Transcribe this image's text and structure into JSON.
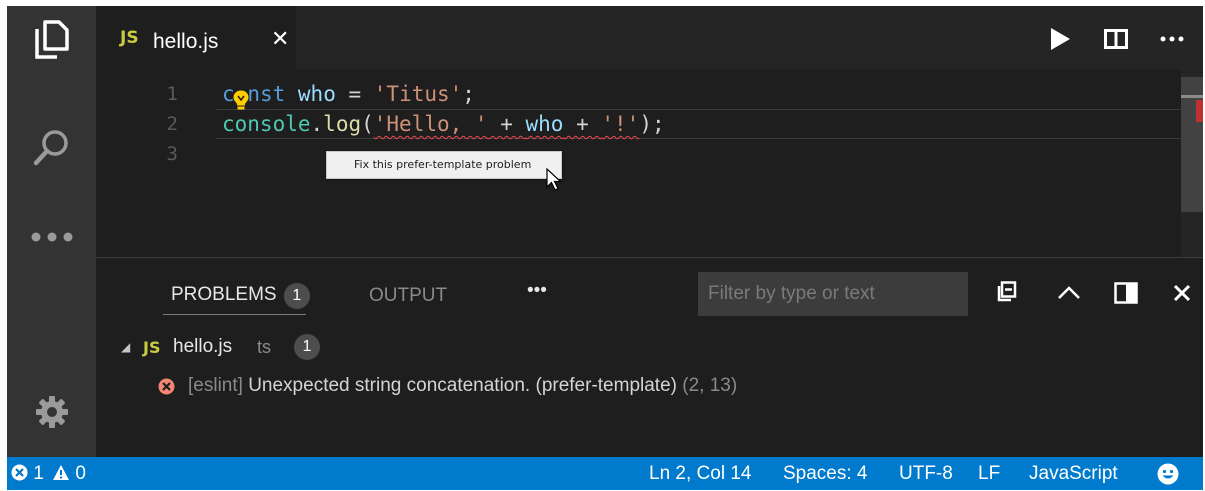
{
  "tab": {
    "lang": "JS",
    "title": "hello.js",
    "close": "✕"
  },
  "editor": {
    "lines": [
      {
        "no": "1",
        "tokens": [
          "c",
          "nst",
          " ",
          "who",
          " = ",
          "'Titus'",
          ";"
        ]
      },
      {
        "no": "2",
        "tokens": [
          "console",
          ".",
          "log",
          "(",
          "'Hello, '",
          " + ",
          "who",
          " + ",
          "'!'",
          ");"
        ]
      },
      {
        "no": "3"
      }
    ],
    "popup_label": "Fix this prefer-template problem"
  },
  "panel": {
    "tabs": {
      "problems": "PROBLEMS",
      "problems_count": "1",
      "output": "OUTPUT",
      "more": "•••"
    },
    "filter_placeholder": "Filter by type or text",
    "tree": {
      "file_lang": "JS",
      "file_name": "hello.js",
      "file_kind": "ts",
      "file_count": "1",
      "problem": {
        "source": "[eslint]",
        "message": "Unexpected string concatenation. (prefer-template)",
        "position": "(2, 13)"
      }
    }
  },
  "statusbar": {
    "errors": "1",
    "warnings": "0",
    "position": "Ln 2, Col 14",
    "spaces": "Spaces: 4",
    "encoding": "UTF-8",
    "eol": "LF",
    "language": "JavaScript"
  },
  "colors": {
    "accent": "#007acc",
    "error": "#f14c4c",
    "js_badge": "#cbcb41"
  },
  "icons": [
    "files-icon",
    "search-icon",
    "more-icon",
    "gear-icon",
    "run-icon",
    "split-editor-icon",
    "lightbulb-icon",
    "collapse-all-icon",
    "chevron-up-icon",
    "toggle-panel-icon",
    "close-icon",
    "error-icon",
    "warning-icon",
    "smiley-icon"
  ]
}
